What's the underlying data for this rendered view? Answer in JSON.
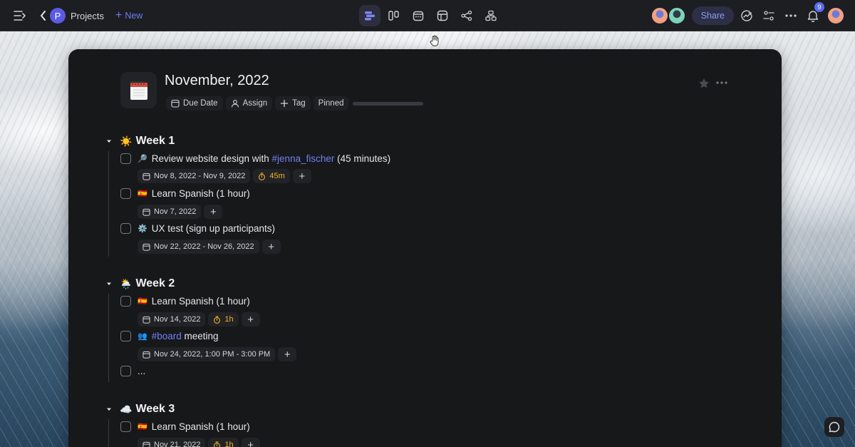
{
  "topbar": {
    "project_initial": "P",
    "project_label": "Projects",
    "new_label": "New",
    "share_label": "Share",
    "notification_count": "9",
    "views": [
      "list-view-icon",
      "board-view-icon",
      "calendar-view-icon",
      "table-view-icon",
      "graph-view-icon",
      "hierarchy-view-icon"
    ]
  },
  "document": {
    "title": "November, 2022",
    "meta": {
      "due_date": "Due Date",
      "assign": "Assign",
      "tag": "Tag",
      "pinned": "Pinned"
    }
  },
  "weeks": [
    {
      "emoji": "☀️",
      "title": "Week 1",
      "tasks": [
        {
          "emoji": "🔎",
          "pre": "Review website design with ",
          "mention": "#jenna_fischer",
          "post": " (45 minutes)",
          "date": "Nov 8, 2022 - Nov 9, 2022",
          "duration": "45m"
        },
        {
          "emoji": "🇪🇸",
          "pre": "Learn Spanish (1 hour)",
          "date": "Nov 7, 2022"
        },
        {
          "emoji": "⚙️",
          "pre": "UX test (sign up participants)",
          "date": "Nov 22, 2022 - Nov 26, 2022"
        }
      ]
    },
    {
      "emoji": "🌦️",
      "title": "Week 2",
      "tasks": [
        {
          "emoji": "🇪🇸",
          "pre": "Learn Spanish (1 hour)",
          "date": "Nov 14, 2022",
          "duration": "1h"
        },
        {
          "emoji": "👥",
          "mention": "#board",
          "post": " meeting",
          "date": "Nov 24, 2022, 1:00 PM - 3:00 PM"
        },
        {
          "pre": "..."
        }
      ]
    },
    {
      "emoji": "☁️",
      "title": "Week 3",
      "tasks": [
        {
          "emoji": "🇪🇸",
          "pre": "Learn Spanish (1 hour)",
          "date": "Nov 21, 2022",
          "duration": "1h"
        }
      ]
    }
  ],
  "colors": {
    "accent": "#6f80f3",
    "duration": "#f0b429",
    "panel": "#17181a",
    "topbar": "#1d1e22"
  }
}
